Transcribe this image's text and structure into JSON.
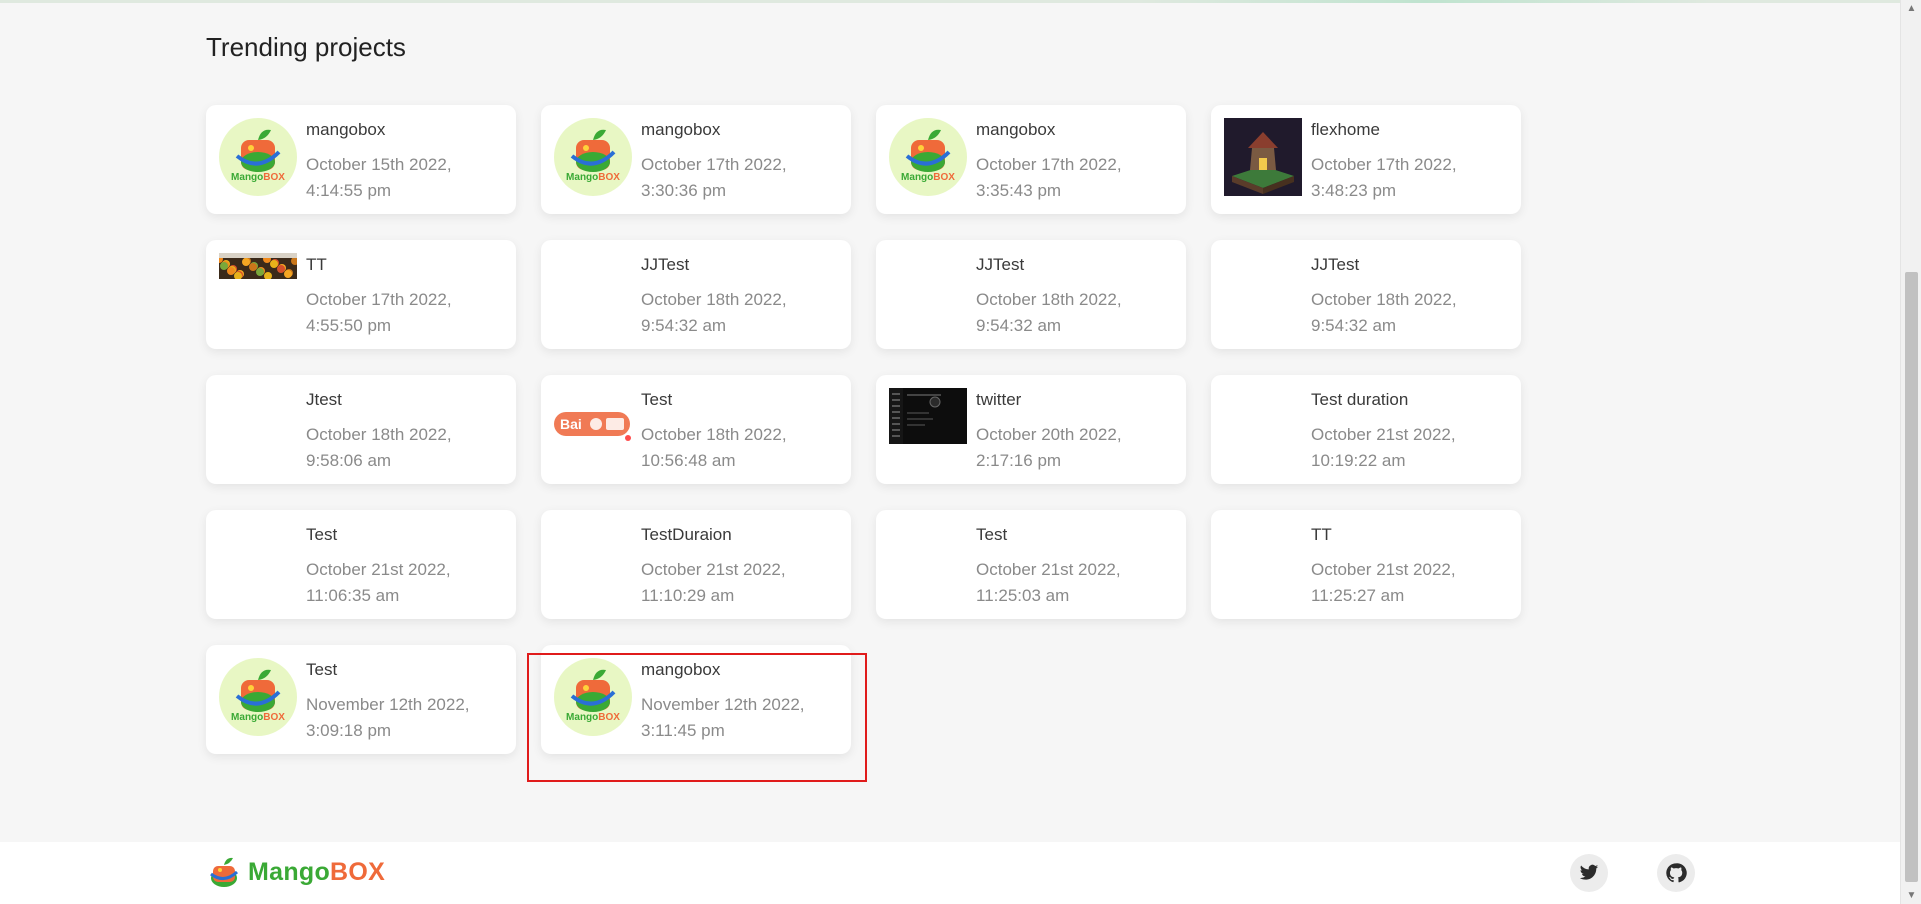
{
  "section": {
    "title": "Trending projects"
  },
  "projects": [
    {
      "name": "mangobox",
      "date": "October 15th 2022, 4:14:55 pm",
      "thumb": "mangobox-logo"
    },
    {
      "name": "mangobox",
      "date": "October 17th 2022, 3:30:36 pm",
      "thumb": "mangobox-logo"
    },
    {
      "name": "mangobox",
      "date": "October 17th 2022, 3:35:43 pm",
      "thumb": "mangobox-logo"
    },
    {
      "name": "flexhome",
      "date": "October 17th 2022, 3:48:23 pm",
      "thumb": "isometric-house-image"
    },
    {
      "name": "TT",
      "date": "October 17th 2022, 4:55:50 pm",
      "thumb": "fruit-market-image"
    },
    {
      "name": "JJTest",
      "date": "October 18th 2022, 9:54:32 am",
      "thumb": ""
    },
    {
      "name": "JJTest",
      "date": "October 18th 2022, 9:54:32 am",
      "thumb": ""
    },
    {
      "name": "JJTest",
      "date": "October 18th 2022, 9:54:32 am",
      "thumb": ""
    },
    {
      "name": "Jtest",
      "date": "October 18th 2022, 9:58:06 am",
      "thumb": ""
    },
    {
      "name": "Test",
      "date": "October 18th 2022, 10:56:48 am",
      "thumb": "baidu-logo"
    },
    {
      "name": "twitter",
      "date": "October 20th 2022, 2:17:16 pm",
      "thumb": "dark-app-screenshot"
    },
    {
      "name": "Test duration",
      "date": "October 21st 2022, 10:19:22 am",
      "thumb": ""
    },
    {
      "name": "Test",
      "date": "October 21st 2022, 11:06:35 am",
      "thumb": ""
    },
    {
      "name": "TestDuraion",
      "date": "October 21st 2022, 11:10:29 am",
      "thumb": ""
    },
    {
      "name": "Test",
      "date": "October 21st 2022, 11:25:03 am",
      "thumb": ""
    },
    {
      "name": "TT",
      "date": "October 21st 2022, 11:25:27 am",
      "thumb": ""
    },
    {
      "name": "Test",
      "date": "November 12th 2022, 3:09:18 pm",
      "thumb": "mangobox-logo"
    },
    {
      "name": "mangobox",
      "date": "November 12th 2022, 3:11:45 pm",
      "thumb": "mangobox-logo"
    }
  ],
  "highlight": {
    "color": "#e01b1b"
  },
  "footer": {
    "brand_mango": "Mango",
    "brand_box": "BOX",
    "icons": [
      "twitter-icon",
      "github-icon"
    ]
  },
  "colors": {
    "brand_green": "#3aa935",
    "brand_orange": "#ef6a3a",
    "page_bg": "#f6f6f6"
  }
}
